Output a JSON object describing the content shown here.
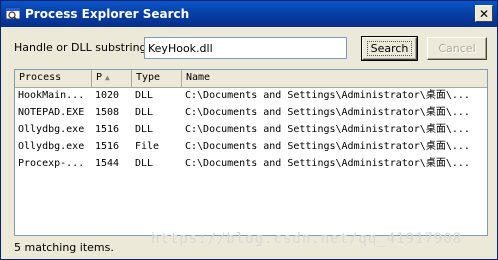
{
  "window": {
    "title": "Process Explorer Search",
    "close_label": "✕"
  },
  "filter": {
    "label": "Handle or DLL substring:",
    "value": "KeyHook.dll"
  },
  "buttons": {
    "search": "Search",
    "cancel": "Cancel"
  },
  "table": {
    "columns": [
      {
        "label": "Process"
      },
      {
        "label": "P"
      },
      {
        "label": "Type"
      },
      {
        "label": "Name"
      }
    ],
    "sort_indicator": "▲",
    "rows": [
      {
        "process": "HookMain...",
        "pid": "1020",
        "type": "DLL",
        "name": "C:\\Documents and Settings\\Administrator\\桌面\\..."
      },
      {
        "process": "NOTEPAD.EXE",
        "pid": "1508",
        "type": "DLL",
        "name": "C:\\Documents and Settings\\Administrator\\桌面\\..."
      },
      {
        "process": "Ollydbg.exe",
        "pid": "1516",
        "type": "DLL",
        "name": "C:\\Documents and Settings\\Administrator\\桌面\\..."
      },
      {
        "process": "Ollydbg.exe",
        "pid": "1516",
        "type": "File",
        "name": "C:\\Documents and Settings\\Administrator\\桌面\\..."
      },
      {
        "process": "Procexp-...",
        "pid": "1544",
        "type": "DLL",
        "name": "C:\\Documents and Settings\\Administrator\\桌面\\..."
      }
    ]
  },
  "status": {
    "text": "5 matching items."
  },
  "watermark": {
    "text": "https://blog.csdn.net/qq_41917908"
  },
  "colors": {
    "titlebar": "#0a4fc2",
    "face": "#ece9d8",
    "border": "#7f9db9"
  }
}
